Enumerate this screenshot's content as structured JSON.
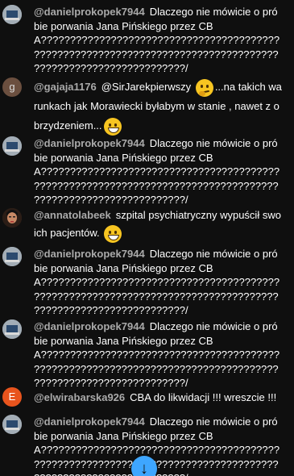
{
  "messages": [
    {
      "author": "@danielprokopek7944",
      "text": "Dlaczego nie mówicie o próbie porwania Jana Pińskiego przez CBA?????????????????????????????????????????????????????????????????????????????????????????????????????????????/",
      "avatar": "laptop"
    },
    {
      "author": "@gajaja1176",
      "text_before": "@SirJarekpierwszy",
      "emoji1": "thinking-face-emoji",
      "text_after": "...na takich warunkach jak Morawiecki byłabym w stanie , nawet z obrzydzeniem...",
      "emoji2": "grinning-face-emoji",
      "avatar_letter": "g"
    },
    {
      "author": "@danielprokopek7944",
      "text": "Dlaczego nie mówicie o próbie porwania Jana Pińskiego przez CBA?????????????????????????????????????????????????????????????????????????????????????????????????????????????/",
      "avatar": "laptop"
    },
    {
      "author": "@annatolabeek",
      "text": "szpital psychiatryczny wypuścił swoich pacjentów.",
      "emoji": "squinting-laugh-emoji",
      "avatar": "photo"
    },
    {
      "author": "@danielprokopek7944",
      "text": "Dlaczego nie mówicie o próbie porwania Jana Pińskiego przez CBA?????????????????????????????????????????????????????????????????????????????????????????????????????????????/",
      "avatar": "laptop"
    },
    {
      "author": "@danielprokopek7944",
      "text": "Dlaczego nie mówicie o próbie porwania Jana Pińskiego przez CBA?????????????????????????????????????????????????????????????????????????????????????????????????????????????/",
      "avatar": "laptop"
    },
    {
      "author": "@elwirabarska926",
      "text": "CBA do likwidacji !!! wreszcie !!!",
      "avatar_letter": "E"
    },
    {
      "author": "@danielprokopek7944",
      "text": "Dlaczego nie mówicie o próbie porwania Jana Pińskiego przez CBA?????????????????????????????????????????????????????????????????????????????????????????????????????????????/",
      "avatar": "laptop"
    }
  ],
  "scroll_button": {
    "icon": "arrow-down-icon",
    "glyph": "↓"
  },
  "colors": {
    "background": "#0f0f0f",
    "author": "#aaaaaa",
    "text": "#ffffff",
    "accent": "#3ea6ff"
  }
}
